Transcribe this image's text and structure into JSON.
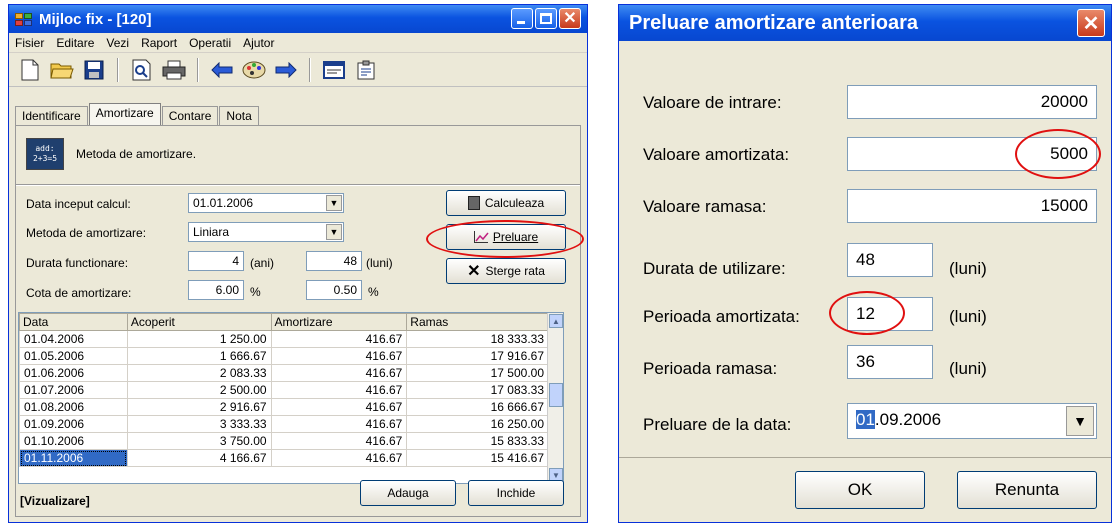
{
  "left_window": {
    "title": "Mijloc fix - [120]",
    "menu": [
      "Fisier",
      "Editare",
      "Vezi",
      "Raport",
      "Operatii",
      "Ajutor"
    ],
    "toolbar_icons": [
      "new-document-icon",
      "open-folder-icon",
      "save-disk-icon",
      "print-preview-icon",
      "print-icon",
      "back-arrow-icon",
      "palette-icon",
      "forward-arrow-icon",
      "window-icon",
      "properties-icon"
    ],
    "tabs": [
      "Identificare",
      "Amortizare",
      "Contare",
      "Nota"
    ],
    "active_tab": "Amortizare",
    "header_icon_text": "add:\n2+3=5",
    "header_text": "Metoda de amortizare.",
    "form": {
      "data_inceput_label": "Data inceput calcul:",
      "data_inceput_value": "01.01.2006",
      "metoda_label": "Metoda de amortizare:",
      "metoda_value": "Liniara",
      "durata_label": "Durata functionare:",
      "durata_ani_value": "4",
      "durata_ani_unit": "(ani)",
      "durata_luni_value": "48",
      "durata_luni_unit": "(luni)",
      "cota_label": "Cota de amortizare:",
      "cota_an_value": "6.00",
      "cota_luna_value": "0.50",
      "pct": "%"
    },
    "buttons": {
      "calculeaza": "Calculeaza",
      "preluare": "Preluare",
      "sterge": "Sterge rata",
      "adauga": "Adauga",
      "inchide": "Inchide"
    },
    "table": {
      "headers": [
        "Data",
        "Acoperit",
        "Amortizare",
        "Ramas"
      ],
      "rows": [
        [
          "01.04.2006",
          "1 250.00",
          "416.67",
          "18 333.33"
        ],
        [
          "01.05.2006",
          "1 666.67",
          "416.67",
          "17 916.67"
        ],
        [
          "01.06.2006",
          "2 083.33",
          "416.67",
          "17 500.00"
        ],
        [
          "01.07.2006",
          "2 500.00",
          "416.67",
          "17 083.33"
        ],
        [
          "01.08.2006",
          "2 916.67",
          "416.67",
          "16 666.67"
        ],
        [
          "01.09.2006",
          "3 333.33",
          "416.67",
          "16 250.00"
        ],
        [
          "01.10.2006",
          "3 750.00",
          "416.67",
          "15 833.33"
        ],
        [
          "01.11.2006",
          "4 166.67",
          "416.67",
          "15 416.67"
        ]
      ],
      "selected_row": 7
    },
    "status": "[Vizualizare]"
  },
  "right_window": {
    "title": "Preluare amortizare anterioara",
    "valoare_intrare_label": "Valoare de intrare:",
    "valoare_intrare_value": "20000",
    "valoare_amortizata_label": "Valoare amortizata:",
    "valoare_amortizata_value": "5000",
    "valoare_ramasa_label": "Valoare ramasa:",
    "valoare_ramasa_value": "15000",
    "durata_label": "Durata de utilizare:",
    "durata_value": "48",
    "perioada_amortizata_label": "Perioada amortizata:",
    "perioada_amortizata_value": "12",
    "perioada_ramasa_label": "Perioada ramasa:",
    "perioada_ramasa_value": "36",
    "luni_unit": "(luni)",
    "preluare_data_label": "Preluare de la data:",
    "preluare_data_day": "01",
    "preluare_data_rest": ".09.2006",
    "ok_label": "OK",
    "renunta_label": "Renunta"
  },
  "colors": {
    "titlebar": "#0a53e0",
    "window_bg": "#ece9d8",
    "highlight": "#316ac5",
    "annotation_red": "#e01010"
  }
}
